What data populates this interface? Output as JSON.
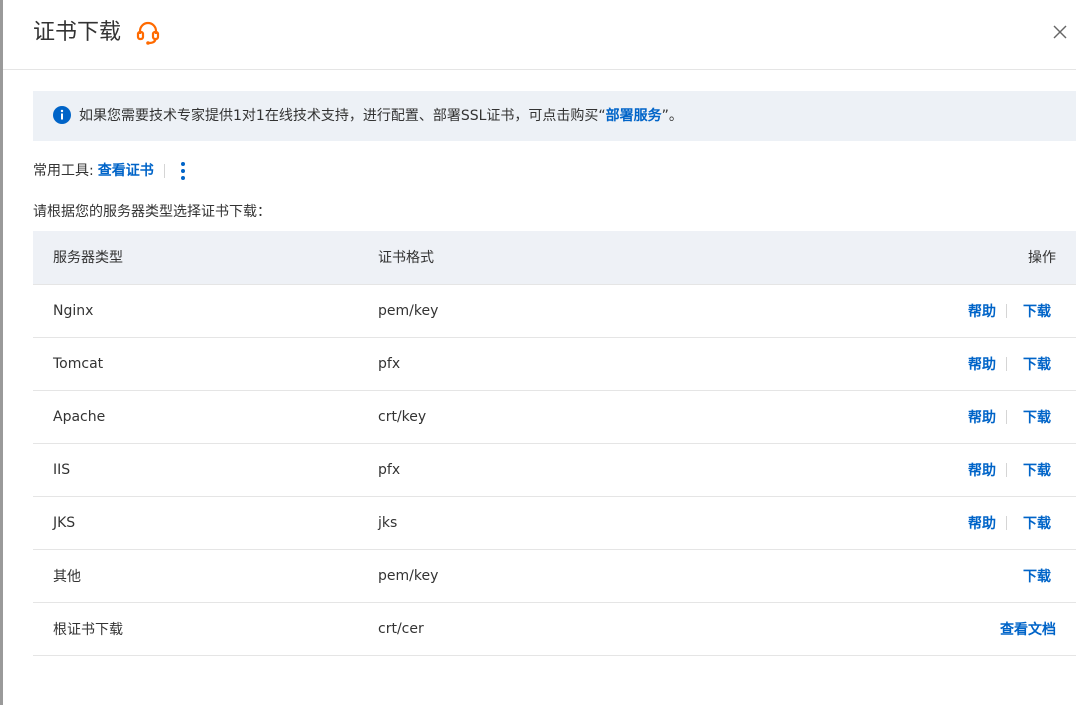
{
  "dialog": {
    "title": "证书下载",
    "close_icon": "close-icon",
    "support_icon": "headset-support-icon"
  },
  "notice": {
    "icon": "info-icon",
    "text_before": "如果您需要技术专家提供1对1在线技术支持，进行配置、部署SSL证书，可点击购买“",
    "link": "部署服务",
    "text_after": "”。"
  },
  "tools": {
    "label": "常用工具:",
    "view_cert": "查看证书",
    "more_icon": "more-vertical-icon"
  },
  "instruction": "请根据您的服务器类型选择证书下载：",
  "table": {
    "headers": [
      "服务器类型",
      "证书格式",
      "操作"
    ],
    "rows": [
      {
        "server": "Nginx",
        "format": "pem/key",
        "help": "帮助",
        "download": "下载"
      },
      {
        "server": "Tomcat",
        "format": "pfx",
        "help": "帮助",
        "download": "下载"
      },
      {
        "server": "Apache",
        "format": "crt/key",
        "help": "帮助",
        "download": "下载"
      },
      {
        "server": "IIS",
        "format": "pfx",
        "help": "帮助",
        "download": "下载"
      },
      {
        "server": "JKS",
        "format": "jks",
        "help": "帮助",
        "download": "下载"
      },
      {
        "server": "其他",
        "format": "pem/key",
        "download": "下载"
      },
      {
        "server": "根证书下载",
        "format": "crt/cer",
        "docs": "查看文档"
      }
    ]
  },
  "colors": {
    "link": "#0064c8",
    "support_icon": "#ff6a00",
    "info_icon": "#0064c8",
    "notice_bg": "#edf1f6",
    "table_header_bg": "#eef1f6"
  }
}
